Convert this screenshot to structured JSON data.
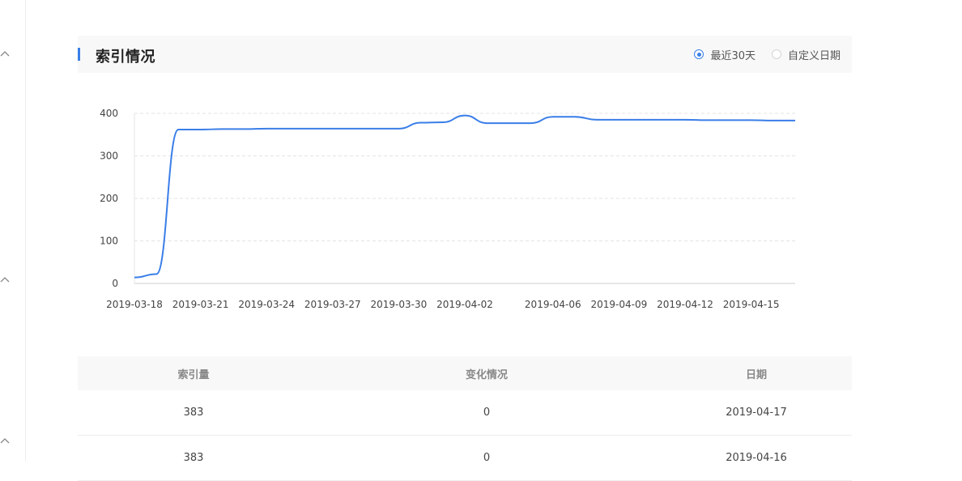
{
  "section": {
    "title": "索引情况",
    "range_options": [
      {
        "label": "最近30天",
        "selected": true
      },
      {
        "label": "自定义日期",
        "selected": false
      }
    ]
  },
  "chart_data": {
    "type": "line",
    "title": "",
    "xlabel": "",
    "ylabel": "",
    "ylim": [
      0,
      400
    ],
    "yticks": [
      0,
      100,
      200,
      300,
      400
    ],
    "xtick_labels": [
      "2019-03-18",
      "2019-03-21",
      "2019-03-24",
      "2019-03-27",
      "2019-03-30",
      "2019-04-02",
      "2019-04-06",
      "2019-04-09",
      "2019-04-12",
      "2019-04-15"
    ],
    "grid": true,
    "line_color": "#3a7ee8",
    "x": [
      "2019-03-18",
      "2019-03-19",
      "2019-03-20",
      "2019-03-21",
      "2019-03-22",
      "2019-03-23",
      "2019-03-24",
      "2019-03-25",
      "2019-03-26",
      "2019-03-27",
      "2019-03-28",
      "2019-03-29",
      "2019-03-30",
      "2019-03-31",
      "2019-04-01",
      "2019-04-02",
      "2019-04-03",
      "2019-04-04",
      "2019-04-05",
      "2019-04-06",
      "2019-04-07",
      "2019-04-08",
      "2019-04-09",
      "2019-04-10",
      "2019-04-11",
      "2019-04-12",
      "2019-04-13",
      "2019-04-14",
      "2019-04-15",
      "2019-04-16",
      "2019-04-17"
    ],
    "series": [
      {
        "values": [
          14,
          22,
          362,
          362,
          363,
          363,
          364,
          364,
          364,
          364,
          364,
          364,
          364,
          378,
          379,
          395,
          377,
          377,
          377,
          392,
          392,
          385,
          385,
          385,
          385,
          385,
          384,
          384,
          384,
          383,
          383
        ]
      }
    ]
  },
  "table": {
    "headers": [
      "索引量",
      "变化情况",
      "日期"
    ],
    "rows": [
      [
        "383",
        "0",
        "2019-04-17"
      ],
      [
        "383",
        "0",
        "2019-04-16"
      ]
    ]
  },
  "colors": {
    "accent": "#3a7ee8",
    "header_bg": "#f8f8f8"
  }
}
